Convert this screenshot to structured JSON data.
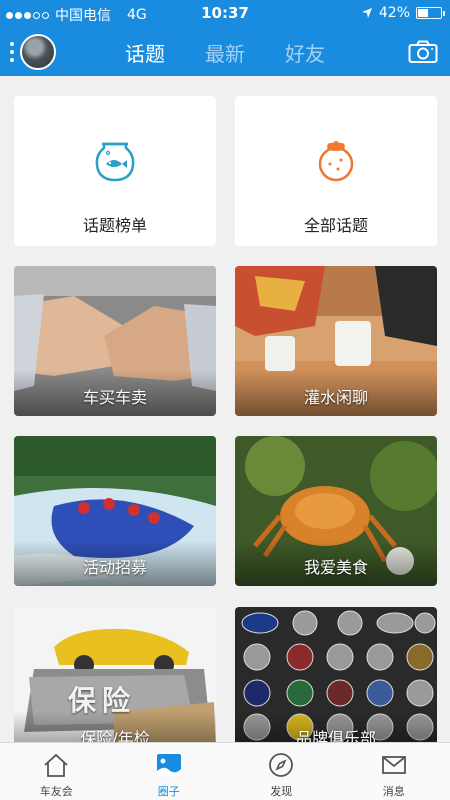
{
  "status": {
    "carrier": "中国电信",
    "network": "4G",
    "time": "10:37",
    "battery": "42%"
  },
  "header": {
    "tabs": [
      {
        "label": "话题",
        "active": true
      },
      {
        "label": "最新",
        "active": false
      },
      {
        "label": "好友",
        "active": false
      }
    ]
  },
  "cards": [
    {
      "label": "话题榜单",
      "icon": "fishbowl-icon"
    },
    {
      "label": "全部话题",
      "icon": "orange-icon"
    },
    {
      "label": "车买车卖",
      "image": "handshake-photo"
    },
    {
      "label": "灌水闲聊",
      "image": "coffee-chat-photo"
    },
    {
      "label": "活动招募",
      "image": "rafting-photo"
    },
    {
      "label": "我爱美食",
      "image": "crab-photo"
    },
    {
      "label": "保险/年检",
      "image": "insurance-photo"
    },
    {
      "label": "品牌俱乐部",
      "image": "car-logos-photo"
    }
  ],
  "insurance_sign": "保险",
  "bottom_nav": [
    {
      "label": "车友会",
      "icon": "home-icon",
      "active": false
    },
    {
      "label": "圈子",
      "icon": "circle-image-icon",
      "active": true
    },
    {
      "label": "发现",
      "icon": "compass-icon",
      "active": false
    },
    {
      "label": "消息",
      "icon": "mail-icon",
      "active": false
    }
  ],
  "colors": {
    "accent": "#1a8ce0",
    "background": "#f0f0f0",
    "fishbowl": "#2aa0c8",
    "orange": "#f07830"
  }
}
